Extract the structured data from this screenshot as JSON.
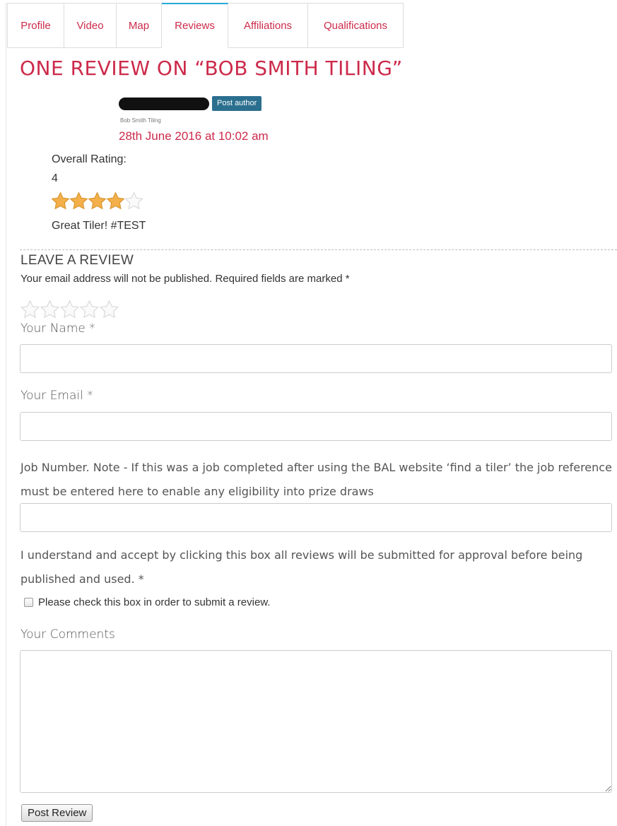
{
  "tabs": [
    {
      "label": "Profile"
    },
    {
      "label": "Video"
    },
    {
      "label": "Map"
    },
    {
      "label": "Reviews"
    },
    {
      "label": "Affiliations"
    },
    {
      "label": "Qualifications"
    }
  ],
  "active_tab": "Reviews",
  "review_section": {
    "title": "ONE REVIEW ON “BOB SMITH TILING”",
    "author_badge": "Post author",
    "author_sub": "Bob Smith Tiling",
    "date": "28th June 2016 at 10:02 am",
    "overall_label": "Overall Rating:",
    "rating_value": "4",
    "rating_stars": 4,
    "rating_max": 5,
    "text": "Great Tiler! #TEST"
  },
  "form": {
    "title": "LEAVE A REVIEW",
    "notice": "Your email address will not be published. Required fields are marked *",
    "name_label": "Your Name *",
    "email_label": "Your Email *",
    "job_label": "Job Number. Note - If this was a job completed after using the BAL website ‘find a tiler’ the job reference must be entered here to enable any eligibility into prize draws",
    "consent_label": "I understand and accept by clicking this box all reviews will be submitted for approval before being published and used. *",
    "checkbox_label": "Please check this box in order to submit a review.",
    "comments_label": "Your Comments",
    "submit_label": "Post Review"
  },
  "colors": {
    "accent": "#cc2a4a",
    "badge": "#2b6f8f",
    "star_filled": "#f3b04a",
    "star_empty": "#e8e8e8"
  }
}
